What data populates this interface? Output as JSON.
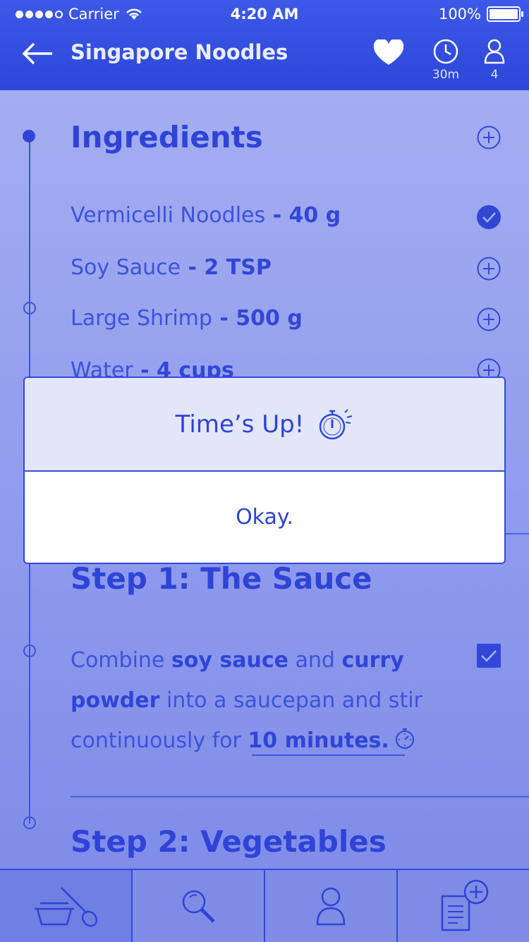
{
  "status_bar": {
    "carrier": "Carrier",
    "time": "4:20 AM",
    "battery": "100%"
  },
  "header": {
    "title": "Singapore Noodles",
    "time_label": "30m",
    "servings_label": "4",
    "icons": [
      "back-arrow-icon",
      "heart-icon",
      "clock-icon",
      "person-icon"
    ]
  },
  "ingredients": {
    "heading": "Ingredients",
    "items": [
      {
        "name": "Vermicelli Noodles",
        "amount": " - 40 g",
        "checked": true
      },
      {
        "name": "Soy Sauce",
        "amount": " - 2 TSP",
        "checked": false
      },
      {
        "name": "Large Shrimp",
        "amount": " - 500 g",
        "checked": false
      },
      {
        "name": "Water",
        "amount": " - 4 cups",
        "checked": false
      }
    ]
  },
  "step1": {
    "heading": "Step 1: The Sauce",
    "text_1": "Combine ",
    "bold_1": "soy sauce",
    "text_2": " and ",
    "bold_2": "curry powder",
    "text_3": " into a saucepan and stir continuously for ",
    "bold_3": "10 minutes.",
    "checked": true
  },
  "step2": {
    "heading": "Step 2: Vegetables"
  },
  "modal": {
    "title": "Time’s Up!",
    "button": "Okay."
  },
  "tabs": [
    "bowl-spoon-icon",
    "search-icon",
    "profile-icon",
    "add-note-icon"
  ],
  "colors": {
    "accent": "#2f43d6",
    "header": "#3550e0",
    "background": "#8f9bed"
  }
}
